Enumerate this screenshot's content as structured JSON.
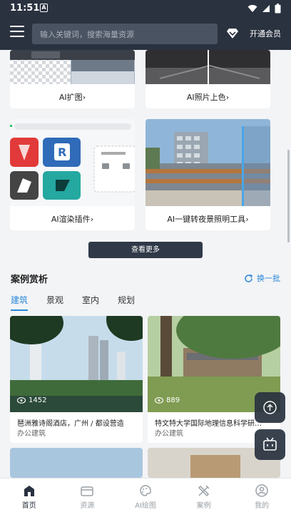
{
  "status": {
    "time": "11:51"
  },
  "header": {
    "search_placeholder": "输入关键词，搜索海量资源",
    "vip_label": "开通会员"
  },
  "features": [
    {
      "label": "AI扩图",
      "arrow": "›"
    },
    {
      "label": "AI照片上色",
      "arrow": "›"
    },
    {
      "label": "AI渲染插件",
      "arrow": "›"
    },
    {
      "label": "AI一键转夜景照明工具",
      "arrow": "›"
    }
  ],
  "more_button": "查看更多",
  "cases_section": {
    "title": "案例赏析",
    "refresh_label": "换一批",
    "tabs": [
      "建筑",
      "景观",
      "室内",
      "规划"
    ],
    "active_tab": "建筑",
    "items": [
      {
        "views": "1452",
        "title": "琶洲雅诗阁酒店，广州 / 都设营造",
        "type": "办公建筑"
      },
      {
        "views": "889",
        "title": "特文特大学国际地理信息科学研…",
        "type": "办公建筑"
      }
    ]
  },
  "bottom_nav": [
    {
      "label": "首页",
      "icon": "home-icon",
      "active": true
    },
    {
      "label": "资源",
      "icon": "folder-icon",
      "active": false
    },
    {
      "label": "AI绘图",
      "icon": "palette-icon",
      "active": false
    },
    {
      "label": "案例",
      "icon": "tools-icon",
      "active": false
    },
    {
      "label": "我的",
      "icon": "user-icon",
      "active": false
    }
  ],
  "colors": {
    "header_bg": "#2a3240",
    "accent": "#2b87d8",
    "button_dark": "#2f3947"
  }
}
